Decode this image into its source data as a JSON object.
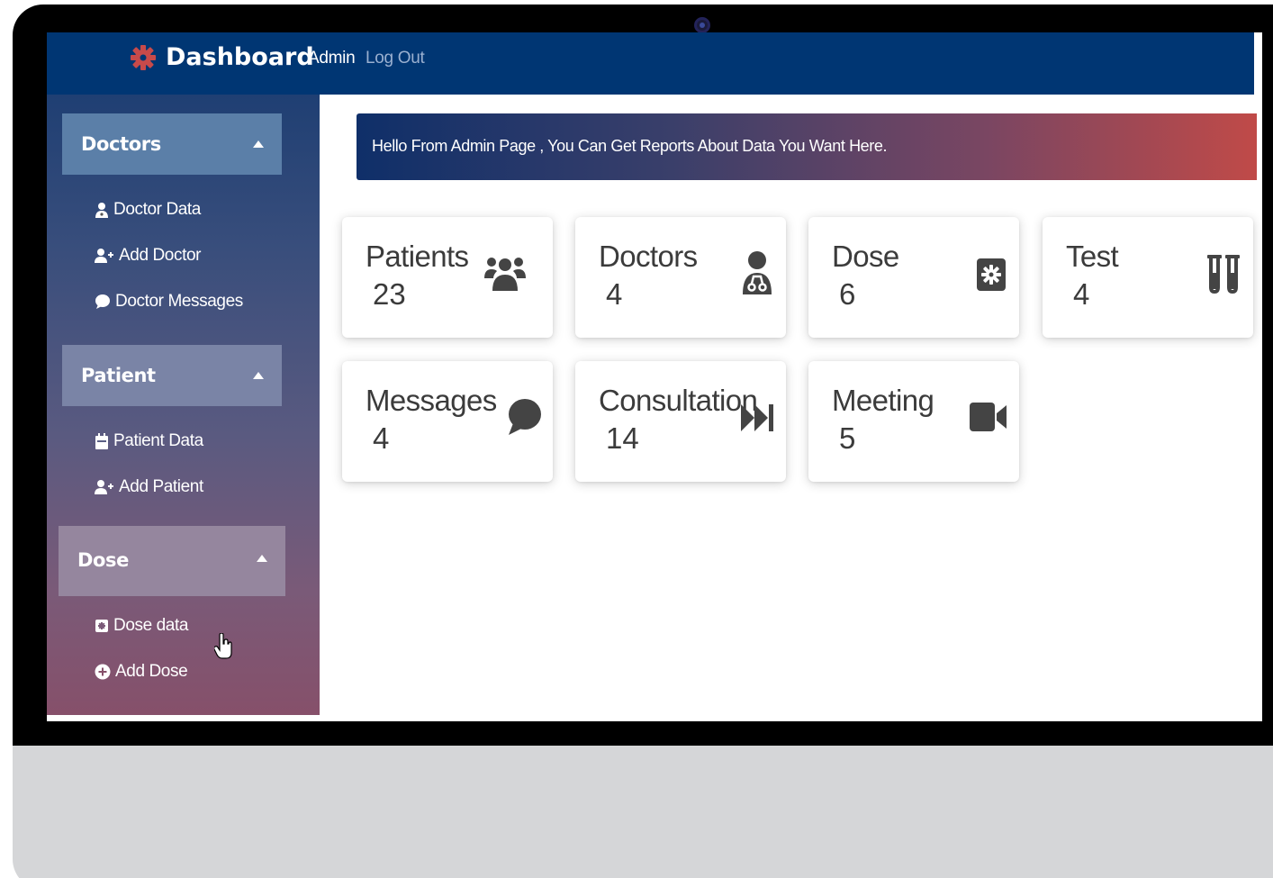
{
  "header": {
    "brand_title": "Dashboard",
    "nav_admin": "Admin",
    "nav_logout": "Log Out",
    "brand_color": "#003673",
    "brand_icon": "gear-icon"
  },
  "sidebar": {
    "groups": [
      {
        "title": "Doctors",
        "items": [
          {
            "label": "Doctor Data",
            "icon": "user-doctor-icon"
          },
          {
            "label": "Add Doctor",
            "icon": "user-plus-icon"
          },
          {
            "label": "Doctor Messages",
            "icon": "comment-icon"
          }
        ]
      },
      {
        "title": "Patient",
        "items": [
          {
            "label": "Patient Data",
            "icon": "calendar-icon"
          },
          {
            "label": "Add Patient",
            "icon": "user-plus-icon"
          }
        ]
      },
      {
        "title": "Dose",
        "items": [
          {
            "label": "Dose data",
            "icon": "medkit-icon"
          },
          {
            "label": "Add Dose",
            "icon": "plus-circle-icon"
          }
        ]
      }
    ]
  },
  "main": {
    "banner": "Hello From Admin Page , You Can Get Reports About Data You Want Here.",
    "cards": [
      {
        "label": "Patients",
        "count": "23",
        "icon": "users-icon"
      },
      {
        "label": "Doctors",
        "count": "4",
        "icon": "user-doctor-icon"
      },
      {
        "label": "Dose",
        "count": "6",
        "icon": "medkit-icon"
      },
      {
        "label": "Test",
        "count": "4",
        "icon": "vials-icon"
      },
      {
        "label": "Messages",
        "count": "4",
        "icon": "comment-icon"
      },
      {
        "label": "Consultation",
        "count": "14",
        "icon": "fast-forward-icon"
      },
      {
        "label": "Meeting",
        "count": "5",
        "icon": "video-icon"
      }
    ]
  }
}
